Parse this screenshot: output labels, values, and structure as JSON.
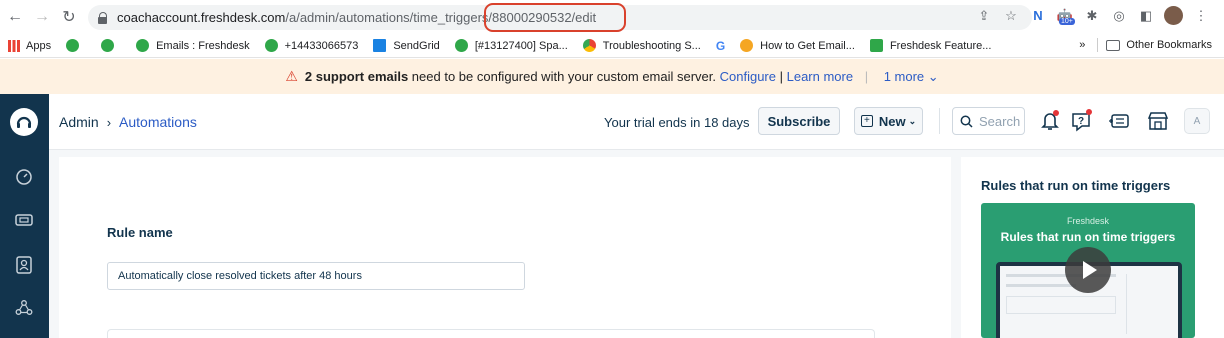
{
  "browser": {
    "url_host": "coachaccount.freshdesk.com",
    "url_path": "/a/admin/automations/time_triggers/",
    "url_highlighted": "88000290532/edit",
    "extension_badge": "10+"
  },
  "bookmarks": {
    "items": [
      {
        "label": "Apps",
        "color": "#4285f4"
      },
      {
        "label": "",
        "color": "#2fa749"
      },
      {
        "label": "",
        "color": "#2fa749"
      },
      {
        "label": "Emails : Freshdesk",
        "color": "#2fa749"
      },
      {
        "label": "+14433066573",
        "color": "#2fa749"
      },
      {
        "label": "SendGrid",
        "color": "#1a82e2"
      },
      {
        "label": "[#13127400] Spa...",
        "color": "#2fa749"
      },
      {
        "label": "Troubleshooting S...",
        "color": "#e8a33c"
      },
      {
        "label": "",
        "color": "#4285f4"
      },
      {
        "label": "How to Get Email...",
        "color": "#f5a623"
      },
      {
        "label": "Freshdesk Feature...",
        "color": "#2fa749"
      }
    ],
    "overflow": "»",
    "other": "Other Bookmarks"
  },
  "banner": {
    "count_text": "2 support emails",
    "message": " need to be configured with your custom email server. ",
    "configure": "Configure",
    "sep": " | ",
    "learn_more": "Learn more",
    "bar": " | ",
    "more": "1 more ⌄"
  },
  "header": {
    "crumb_admin": "Admin",
    "crumb_sep": "›",
    "crumb_automations": "Automations",
    "trial": "Your trial ends in 18 days",
    "subscribe": "Subscribe",
    "new": "New",
    "search_placeholder": "Search",
    "avatar": "A"
  },
  "form": {
    "rule_name_label": "Rule name",
    "rule_name_value": "Automatically close resolved tickets after 48 hours"
  },
  "sidebar_panel": {
    "title": "Rules that run on time triggers",
    "video_brand": "Freshdesk",
    "video_title": "Rules that run on time triggers"
  }
}
